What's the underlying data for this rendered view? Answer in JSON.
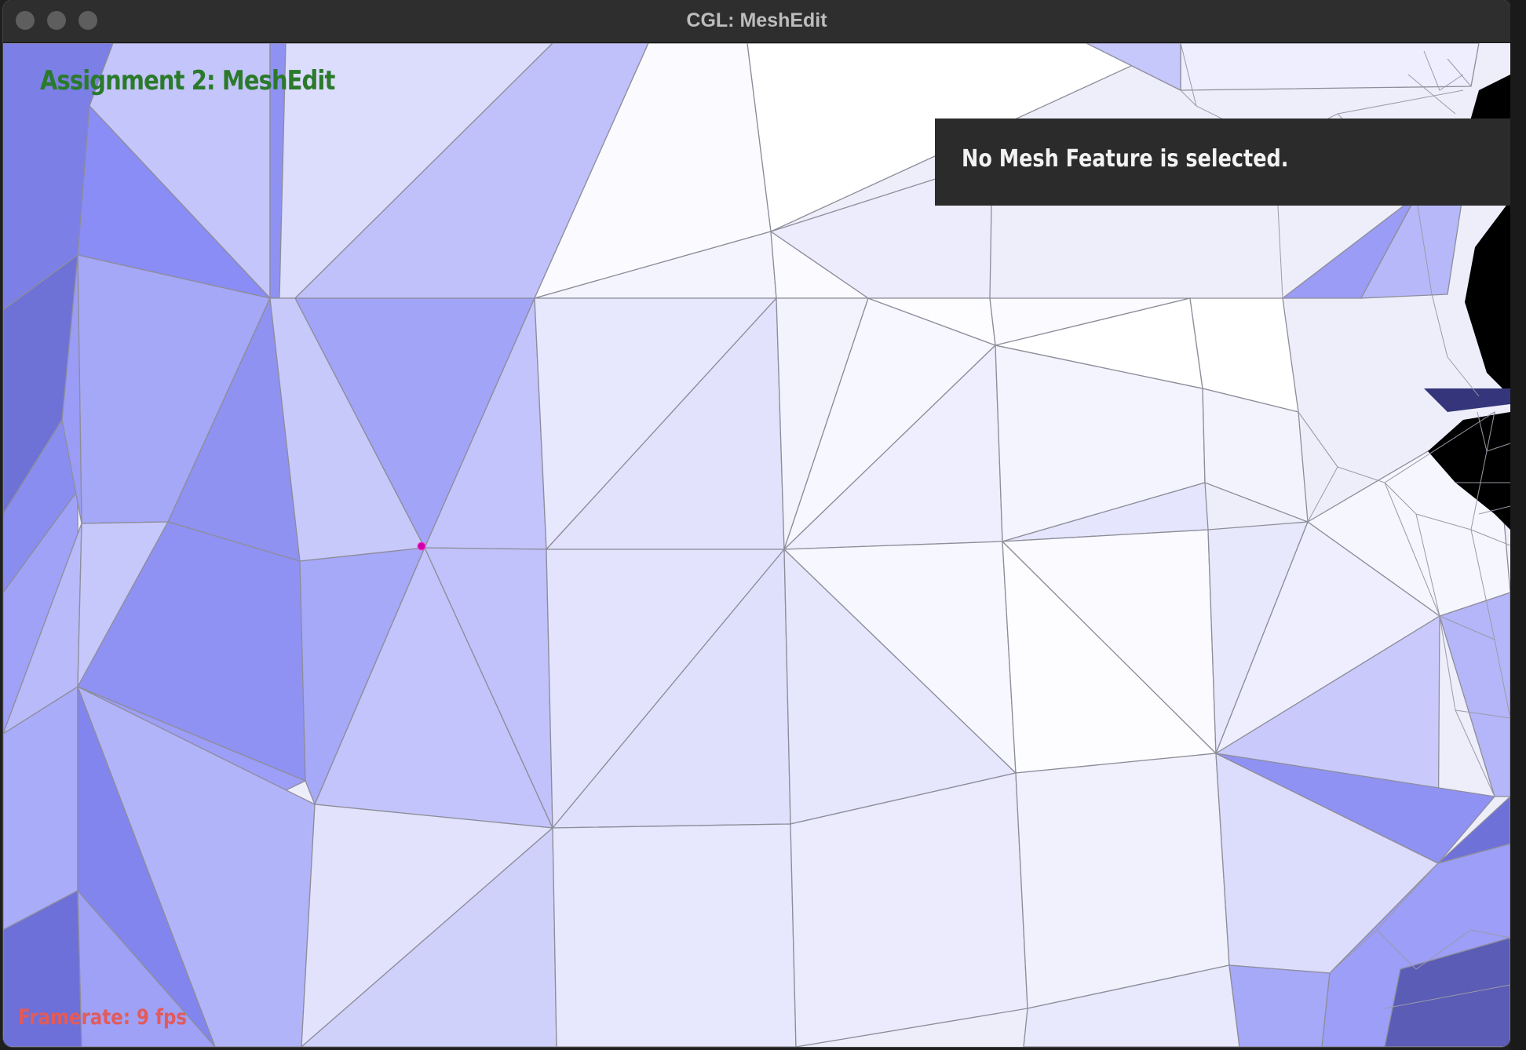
{
  "window": {
    "title": "CGL: MeshEdit"
  },
  "viewport": {
    "heading": "Assignment 2: MeshEdit",
    "selection_panel": {
      "message": "No Mesh Feature is selected."
    },
    "framerate": "Framerate: 9 fps",
    "selected_vertex_color": "#cc00aa"
  },
  "colors": {
    "mesh_edge": "#8d8d9a",
    "heading": "#2a7a2a",
    "framerate": "#e25b5b",
    "panel_bg": "#2b2b2b"
  }
}
